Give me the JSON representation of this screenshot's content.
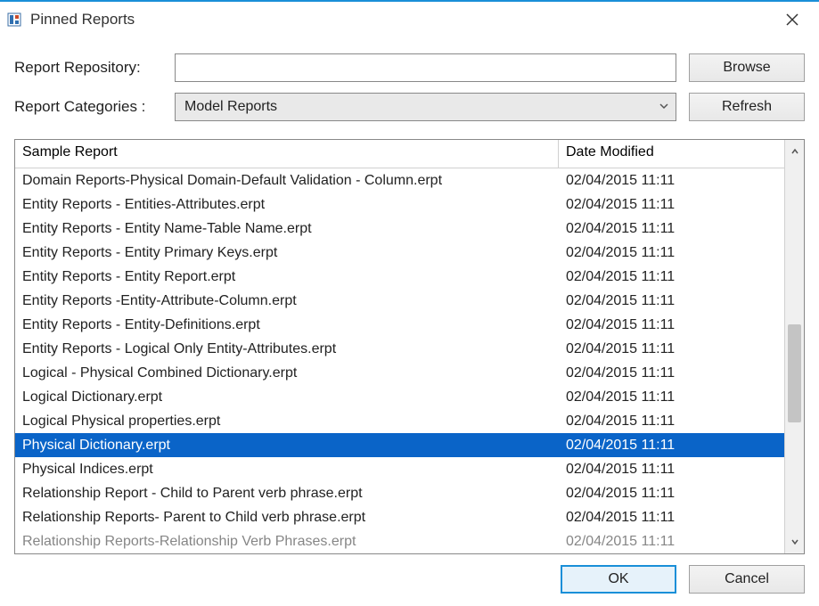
{
  "window": {
    "title": "Pinned Reports"
  },
  "form": {
    "repo_label": "Report Repository:",
    "repo_value": "",
    "categories_label": "Report Categories :",
    "category_selected": "Model Reports",
    "browse_label": "Browse",
    "refresh_label": "Refresh"
  },
  "table": {
    "col_name": "Sample Report",
    "col_date": "Date Modified",
    "selected_index": 11,
    "rows": [
      {
        "name": "Domain Reports-Physical Domain-Default Validation - Column.erpt",
        "date": "02/04/2015 11:11"
      },
      {
        "name": "Entity Reports - Entities-Attributes.erpt",
        "date": "02/04/2015 11:11"
      },
      {
        "name": "Entity Reports - Entity Name-Table Name.erpt",
        "date": "02/04/2015 11:11"
      },
      {
        "name": "Entity Reports - Entity Primary Keys.erpt",
        "date": "02/04/2015 11:11"
      },
      {
        "name": "Entity Reports - Entity Report.erpt",
        "date": "02/04/2015 11:11"
      },
      {
        "name": "Entity Reports  -Entity-Attribute-Column.erpt",
        "date": "02/04/2015 11:11"
      },
      {
        "name": "Entity Reports - Entity-Definitions.erpt",
        "date": "02/04/2015 11:11"
      },
      {
        "name": "Entity Reports - Logical Only Entity-Attributes.erpt",
        "date": "02/04/2015 11:11"
      },
      {
        "name": "Logical - Physical Combined Dictionary.erpt",
        "date": "02/04/2015 11:11"
      },
      {
        "name": "Logical Dictionary.erpt",
        "date": "02/04/2015 11:11"
      },
      {
        "name": "Logical Physical properties.erpt",
        "date": "02/04/2015 11:11"
      },
      {
        "name": "Physical Dictionary.erpt",
        "date": "02/04/2015 11:11"
      },
      {
        "name": "Physical Indices.erpt",
        "date": "02/04/2015 11:11"
      },
      {
        "name": "Relationship Report - Child to Parent verb phrase.erpt",
        "date": "02/04/2015 11:11"
      },
      {
        "name": "Relationship Reports- Parent to Child verb phrase.erpt",
        "date": "02/04/2015 11:11"
      },
      {
        "name": "Relationship Reports-Relationship Verb Phrases.erpt",
        "date": "02/04/2015 11:11"
      }
    ]
  },
  "footer": {
    "ok_label": "OK",
    "cancel_label": "Cancel"
  }
}
